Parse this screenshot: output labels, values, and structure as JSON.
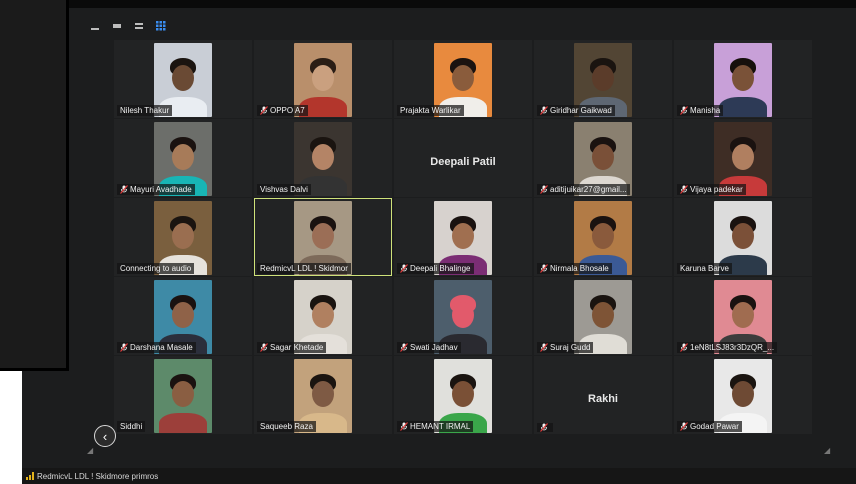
{
  "toolbar": {
    "icons": [
      "minimize-icon",
      "restore-icon",
      "window-icon",
      "gallery-grid-icon"
    ]
  },
  "participants": [
    {
      "label": "Nilesh Thakur",
      "muted": false,
      "photo": {
        "bg": "#c9ced6",
        "skin": "#6a4a34",
        "hair": "#1a1410",
        "shirt": "#e9edf2"
      }
    },
    {
      "label": "OPPO A7",
      "muted": true,
      "photo": {
        "bg": "#b98f6b",
        "skin": "#caa07f",
        "hair": "#2a1d15",
        "shirt": "#b3362c"
      }
    },
    {
      "label": "Prajakta Warlikar",
      "muted": false,
      "photo": {
        "bg": "#e88a3e",
        "skin": "#8a5c3c",
        "hair": "#1b1310",
        "shirt": "#f0eeea"
      }
    },
    {
      "label": "Giridhar Gaikwad",
      "muted": true,
      "photo": {
        "bg": "#524534",
        "skin": "#5b3c2a",
        "hair": "#1a1410",
        "shirt": "#5e6773"
      }
    },
    {
      "label": "Manisha",
      "muted": true,
      "photo": {
        "bg": "#c8a0d8",
        "skin": "#7a5238",
        "hair": "#16100c",
        "shirt": "#2d3a56"
      }
    },
    {
      "label": "Mayuri Avadhade",
      "muted": true,
      "photo": {
        "bg": "#6c6e6a",
        "skin": "#a77b59",
        "hair": "#1a1210",
        "shirt": "#18b5b5"
      }
    },
    {
      "label": "Vishvas Dalvi",
      "muted": false,
      "photo": {
        "bg": "#3b3530",
        "skin": "#b48466",
        "hair": "#1a1410",
        "shirt": "#333333"
      }
    },
    {
      "label": "",
      "muted": false,
      "center_name": "Deepali Patil"
    },
    {
      "label": "aditijuikar27@gmail...",
      "muted": true,
      "photo": {
        "bg": "#8a8070",
        "skin": "#7a5038",
        "hair": "#1a1210",
        "shirt": "#dcd7d0"
      }
    },
    {
      "label": "Vijaya padekar",
      "muted": true,
      "photo": {
        "bg": "#3e2d25",
        "skin": "#b07f60",
        "hair": "#1a1210",
        "shirt": "#c73a3a"
      }
    },
    {
      "label": "Connecting to audio",
      "muted": false,
      "photo": {
        "bg": "#7a5f3e",
        "skin": "#9a6e50",
        "hair": "#1a1410",
        "shirt": "#e6e2dc"
      }
    },
    {
      "label": "RedmicvL LDL ! Skidmor",
      "muted": false,
      "active": true,
      "photo": {
        "bg": "#a69884",
        "skin": "#9b6e56",
        "hair": "#1a1210",
        "shirt": "#7d6a5a"
      }
    },
    {
      "label": "Deepali Bhalinge",
      "muted": true,
      "photo": {
        "bg": "#d7d2ce",
        "skin": "#a06f50",
        "hair": "#1a1210",
        "shirt": "#7b2d74"
      }
    },
    {
      "label": "Nirmala Bhosale",
      "muted": true,
      "photo": {
        "bg": "#b27b46",
        "skin": "#8a5a3c",
        "hair": "#1a1210",
        "shirt": "#3b5a96"
      }
    },
    {
      "label": "Karuna Barve",
      "muted": false,
      "photo": {
        "bg": "#dcdcdc",
        "skin": "#7b5038",
        "hair": "#1a1210",
        "shirt": "#2c3a4a"
      }
    },
    {
      "label": "Darshana Masale",
      "muted": true,
      "photo": {
        "bg": "#3e8aa6",
        "skin": "#8f6248",
        "hair": "#1a1210",
        "shirt": "#2b2f3c"
      }
    },
    {
      "label": "Sagar Khetade",
      "muted": true,
      "photo": {
        "bg": "#d6d2ca",
        "skin": "#b08060",
        "hair": "#1a1410",
        "shirt": "#e4e0da"
      }
    },
    {
      "label": "Swati Jadhav",
      "muted": true,
      "photo": {
        "bg": "#4d5e6c",
        "skin": "#e25a6b",
        "hair": "#e25a6b",
        "shirt": "#2a2a30"
      }
    },
    {
      "label": "Suraj Gudd",
      "muted": true,
      "photo": {
        "bg": "#9d9a94",
        "skin": "#7e5436",
        "hair": "#1a1410",
        "shirt": "#e0ddd6"
      }
    },
    {
      "label": "1eN8tLSJ83r3DzQR_...",
      "muted": true,
      "photo": {
        "bg": "#e08a93",
        "skin": "#a06c50",
        "hair": "#1a1210",
        "shirt": "#3c3c3c"
      }
    },
    {
      "label": "Siddhi",
      "muted": false,
      "photo": {
        "bg": "#5d8a6a",
        "skin": "#8a5e42",
        "hair": "#1a1210",
        "shirt": "#9c3f3a"
      }
    },
    {
      "label": "Saqueeb Raza",
      "muted": false,
      "photo": {
        "bg": "#c2a27c",
        "skin": "#7e5a44",
        "hair": "#1a1410",
        "shirt": "#d8b88a"
      }
    },
    {
      "label": "HEMANT IRMAL",
      "muted": true,
      "photo": {
        "bg": "#e0e0dc",
        "skin": "#7a5036",
        "hair": "#1a1410",
        "shirt": "#3aa64a"
      }
    },
    {
      "label": "",
      "muted": true,
      "center_name": "Rakhi"
    },
    {
      "label": "Godad Pawar",
      "muted": true,
      "photo": {
        "bg": "#e8e8e8",
        "skin": "#6e4a34",
        "hair": "#1a1410",
        "shirt": "#f4f4f4"
      }
    }
  ],
  "status_bar": {
    "text": "RedmicvL LDL ! Skidmore primros"
  },
  "nav": {
    "back_label": "‹"
  }
}
